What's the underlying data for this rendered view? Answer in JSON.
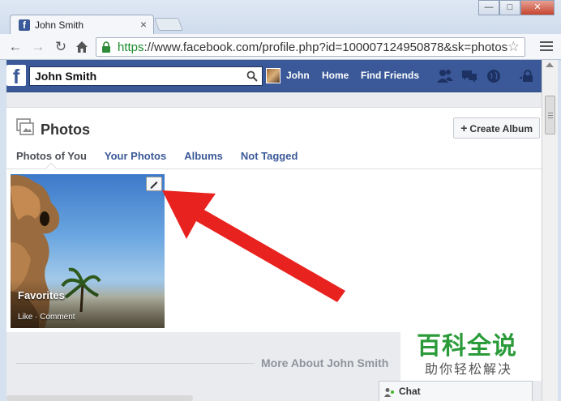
{
  "browser": {
    "tab_title": "John Smith",
    "tab_close": "×",
    "url_scheme": "https",
    "url_rest": "://www.facebook.com/profile.php?id=100007124950878&sk=photos",
    "window_buttons": [
      "—",
      "□",
      "✕"
    ]
  },
  "fb_header": {
    "logo": "f",
    "search_value": "John Smith",
    "user_name": "John",
    "home_label": "Home",
    "find_friends_label": "Find Friends"
  },
  "photos": {
    "title": "Photos",
    "create_album_icon": "+",
    "create_album_label": "Create Album",
    "tabs": [
      {
        "label": "Photos of You",
        "active": true
      },
      {
        "label": "Your Photos",
        "active": false
      },
      {
        "label": "Albums",
        "active": false
      },
      {
        "label": "Not Tagged",
        "active": false
      }
    ],
    "album": {
      "name": "Favorites",
      "actions": "Like · Comment"
    }
  },
  "more_about": "More About John Smith",
  "watermark": {
    "big": "百科全说",
    "small": "助你轻松解决"
  },
  "chat": {
    "label": "Chat"
  },
  "colors": {
    "facebook_blue": "#3b5998",
    "arrow_red": "#e8231f",
    "watermark_green": "#2b9b3a"
  }
}
